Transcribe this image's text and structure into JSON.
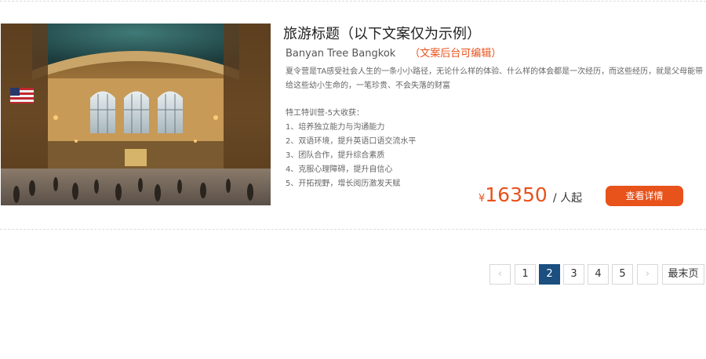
{
  "item": {
    "title": "旅游标题（以下文案仅为示例）",
    "hotel_name": "Banyan Tree Bangkok",
    "hotel_note": "（文案后台可编辑）",
    "description": "夏令营是TA感受社会人生的一条小小路径，无论什么样的体验、什么样的体会都是一次经历，而这些经历，就是父母能带给这些幼小生命的，一笔珍贵、不会失落的财富",
    "features_title": "特工特训营-5大收获：",
    "features": [
      "1、培养独立能力与沟通能力",
      "2、双语环境，提升英语口语交流水平",
      "3、团队合作，提升综合素质",
      "4、克服心理障碍，提升自信心",
      "5、开拓视野，增长阅历激发天赋"
    ],
    "price_currency": "¥",
    "price_amount": "16350",
    "price_unit": "/ 人起",
    "detail_button": "查看详情"
  },
  "pagination": {
    "prev_icon": "‹",
    "next_icon": "›",
    "pages": [
      "1",
      "2",
      "3",
      "4",
      "5"
    ],
    "current_page": "2",
    "last_label": "最末页"
  },
  "colors": {
    "accent": "#e8521b",
    "active_page": "#1a4f80"
  }
}
